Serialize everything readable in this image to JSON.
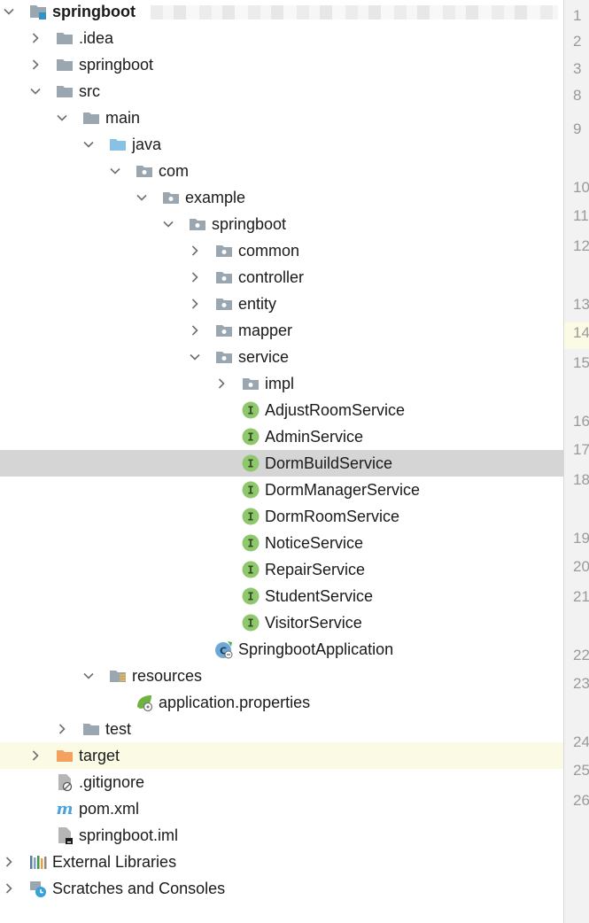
{
  "tree": {
    "root": "springboot",
    "items": [
      {
        "label": ".idea"
      },
      {
        "label": "springboot"
      },
      {
        "label": "src"
      },
      {
        "label": "main"
      },
      {
        "label": "java"
      },
      {
        "label": "com"
      },
      {
        "label": "example"
      },
      {
        "label": "springboot"
      },
      {
        "label": "common"
      },
      {
        "label": "controller"
      },
      {
        "label": "entity"
      },
      {
        "label": "mapper"
      },
      {
        "label": "service"
      },
      {
        "label": "impl"
      },
      {
        "label": "AdjustRoomService"
      },
      {
        "label": "AdminService"
      },
      {
        "label": "DormBuildService"
      },
      {
        "label": "DormManagerService"
      },
      {
        "label": "DormRoomService"
      },
      {
        "label": "NoticeService"
      },
      {
        "label": "RepairService"
      },
      {
        "label": "StudentService"
      },
      {
        "label": "VisitorService"
      },
      {
        "label": "SpringbootApplication"
      },
      {
        "label": "resources"
      },
      {
        "label": "application.properties"
      },
      {
        "label": "test"
      },
      {
        "label": "target"
      },
      {
        "label": ".gitignore"
      },
      {
        "label": "pom.xml"
      },
      {
        "label": "springboot.iml"
      },
      {
        "label": "External Libraries"
      },
      {
        "label": "Scratches and Consoles"
      }
    ],
    "selected": "DormBuildService"
  },
  "gutter": {
    "line_numbers": [
      "1",
      "2",
      "3",
      "8",
      "9",
      "10",
      "11",
      "12",
      "13",
      "14",
      "15",
      "16",
      "17",
      "18",
      "19",
      "20",
      "21",
      "22",
      "23",
      "24",
      "25",
      "26"
    ]
  },
  "colors": {
    "folder": "#9aa7b0",
    "source_folder": "#87c2e6",
    "excluded_folder": "#f4a05e",
    "interface_icon": "#8fc76d",
    "selection": "#d5d5d5",
    "caret_line": "#fbfae4"
  }
}
